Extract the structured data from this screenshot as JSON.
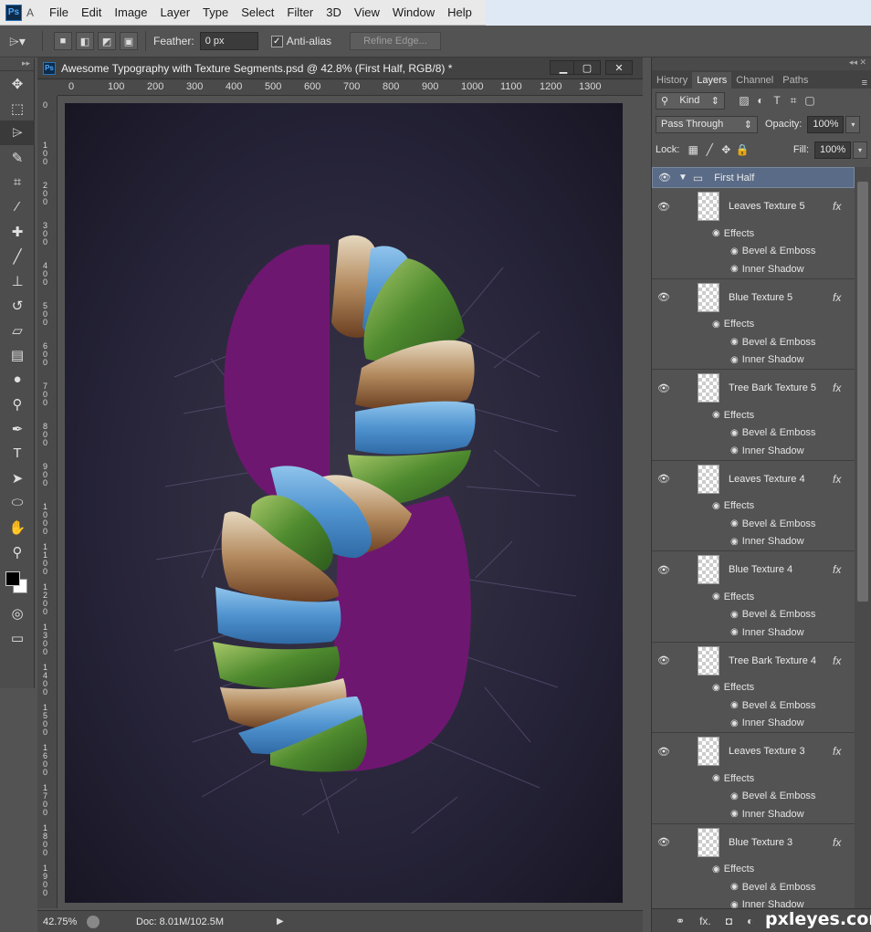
{
  "app": {
    "logo": "Ps",
    "trailing_letter": "A",
    "menus": [
      "File",
      "Edit",
      "Image",
      "Layer",
      "Type",
      "Select",
      "Filter",
      "3D",
      "View",
      "Window",
      "Help"
    ]
  },
  "options_bar": {
    "feather_label": "Feather:",
    "feather_value": "0 px",
    "antialias_label": "Anti-alias",
    "refine_edge_label": "Refine Edge..."
  },
  "document": {
    "icon": "Ps",
    "title": "Awesome Typography with Texture Segments.psd @ 42.8% (First Half, RGB/8) *",
    "ruler_top": [
      "0",
      "100",
      "200",
      "300",
      "400",
      "500",
      "600",
      "700",
      "800",
      "900",
      "1000",
      "1100",
      "1200",
      "1300"
    ],
    "ruler_left": [
      "0",
      "100",
      "200",
      "300",
      "400",
      "500",
      "600",
      "700",
      "800",
      "900",
      "1000",
      "1100",
      "1200",
      "1300",
      "1400",
      "1500",
      "1600",
      "1700",
      "1800",
      "1900"
    ],
    "zoom": "42.75%",
    "doc_info": "Doc: 8.01M/102.5M",
    "colors": {
      "purple": "#6e1770",
      "bg": "#221f2e"
    }
  },
  "panel": {
    "tabs": [
      "History",
      "Layers",
      "Channel",
      "Paths"
    ],
    "active_tab": "Layers",
    "kind_label": "Kind",
    "blend_mode": "Pass Through",
    "opacity_label": "Opacity:",
    "opacity_value": "100%",
    "lock_label": "Lock:",
    "fill_label": "Fill:",
    "fill_value": "100%",
    "group_name": "First Half",
    "layers": [
      {
        "name": "Leaves Texture 5",
        "effects_label": "Effects",
        "effects": [
          "Bevel & Emboss",
          "Inner Shadow"
        ]
      },
      {
        "name": "Blue Texture  5",
        "effects_label": "Effects",
        "effects": [
          "Bevel & Emboss",
          "Inner Shadow"
        ]
      },
      {
        "name": "Tree Bark Texture 5",
        "effects_label": "Effects",
        "effects": [
          "Bevel & Emboss",
          "Inner Shadow"
        ]
      },
      {
        "name": "Leaves Texture 4",
        "effects_label": "Effects",
        "effects": [
          "Bevel & Emboss",
          "Inner Shadow"
        ]
      },
      {
        "name": "Blue Texture 4",
        "effects_label": "Effects",
        "effects": [
          "Bevel & Emboss",
          "Inner Shadow"
        ]
      },
      {
        "name": "Tree Bark Texture 4",
        "effects_label": "Effects",
        "effects": [
          "Bevel & Emboss",
          "Inner Shadow"
        ]
      },
      {
        "name": "Leaves Texture 3",
        "effects_label": "Effects",
        "effects": [
          "Bevel & Emboss",
          "Inner Shadow"
        ]
      },
      {
        "name": "Blue Texture 3",
        "effects_label": "Effects",
        "effects": [
          "Bevel & Emboss",
          "Inner Shadow"
        ]
      }
    ]
  },
  "watermark": "pxleyes.com"
}
